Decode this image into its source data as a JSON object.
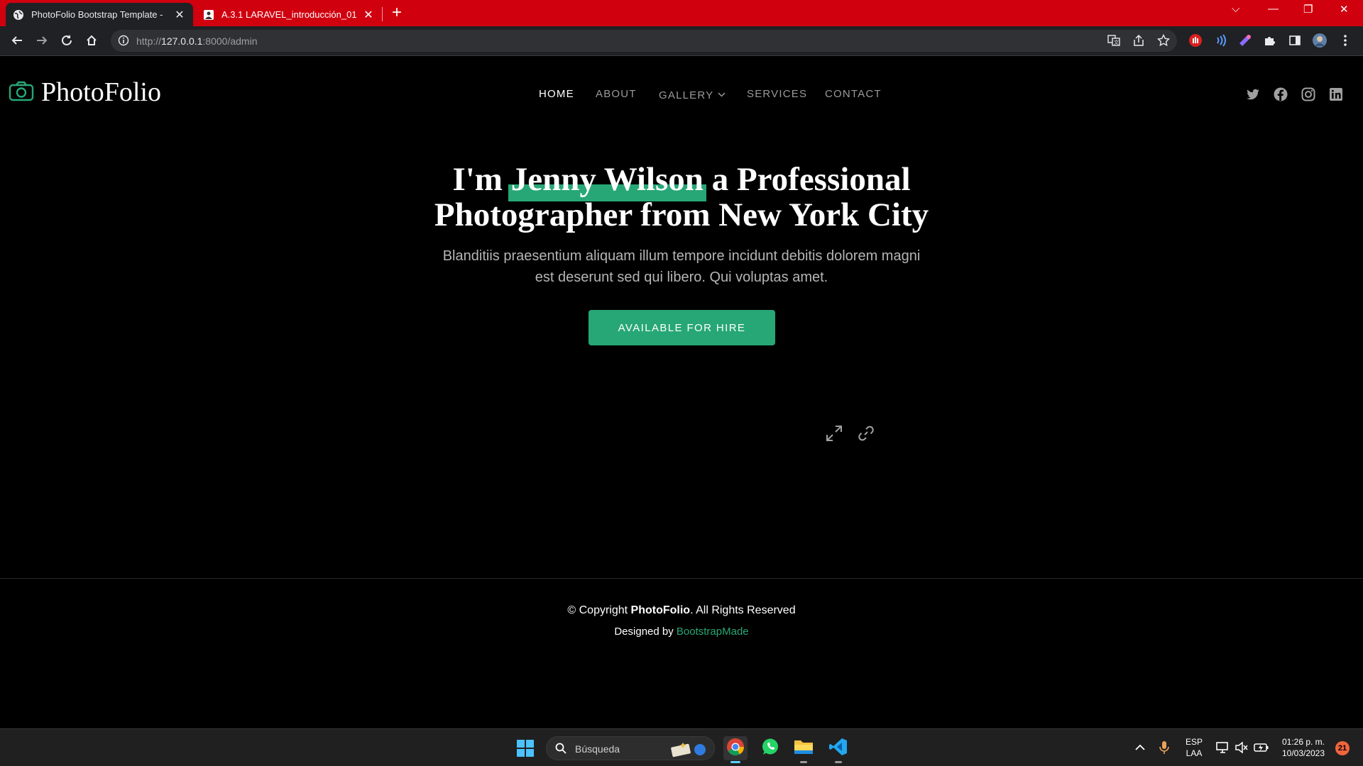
{
  "browser": {
    "tabs": [
      {
        "title": "PhotoFolio Bootstrap Template -",
        "active": true
      },
      {
        "title": "A.3.1 LARAVEL_introducción_01",
        "active": false
      }
    ],
    "url_prefix": "http://",
    "url_host": "127.0.0.1",
    "url_rest": ":8000/admin"
  },
  "site": {
    "logo": "PhotoFolio",
    "nav": [
      {
        "label": "HOME",
        "active": true
      },
      {
        "label": "ABOUT",
        "active": false
      },
      {
        "label": "GALLERY",
        "active": false,
        "dropdown": true
      },
      {
        "label": "SERVICES",
        "active": false
      },
      {
        "label": "CONTACT",
        "active": false
      }
    ],
    "socials": [
      "twitter-icon",
      "facebook-icon",
      "instagram-icon",
      "linkedin-icon"
    ]
  },
  "hero": {
    "title_pre": "I'm ",
    "title_name": "Jenny Wilson",
    "title_post": " a Professional",
    "title_line2": "Photographer from New York City",
    "subtitle": "Blanditiis praesentium aliquam illum tempore incidunt debitis dolorem magni est deserunt sed qui libero. Qui voluptas amet.",
    "cta": "AVAILABLE FOR HIRE"
  },
  "footer": {
    "copyright_pre": "© Copyright ",
    "copyright_brand": "PhotoFolio",
    "copyright_post": ". All Rights Reserved",
    "designed_by": "Designed by ",
    "designer": "BootstrapMade"
  },
  "taskbar": {
    "search_placeholder": "Búsqueda",
    "lang_top": "ESP",
    "lang_bottom": "LAA",
    "time": "01:26 p. m.",
    "date": "10/03/2023",
    "notifications": "21"
  },
  "colors": {
    "accent": "#27a776",
    "chrome_frame": "#d0000f",
    "page_bg": "#000000"
  }
}
